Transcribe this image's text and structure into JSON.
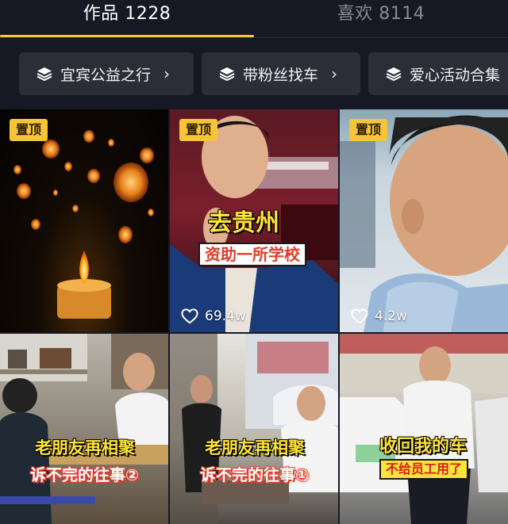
{
  "tabs": {
    "works": "作品 1228",
    "likes": "喜欢 8114"
  },
  "collections": [
    {
      "label": "宜宾公益之行",
      "chevron": "›"
    },
    {
      "label": "带粉丝找车",
      "chevron": "›"
    },
    {
      "label": "爱心活动合集"
    }
  ],
  "videos": [
    {
      "pinned": "置顶"
    },
    {
      "pinned": "置顶",
      "caption_main": "去贵州",
      "caption_sub": "资助一所学校",
      "likes": "69.4w"
    },
    {
      "pinned": "置顶",
      "likes": "4.2w"
    },
    {
      "caption_main": "老朋友再相聚",
      "caption_sub": "诉不完的往事②"
    },
    {
      "caption_main": "老朋友再相聚",
      "caption_sub": "诉不完的往事①"
    },
    {
      "caption_main": "收回我的车",
      "caption_sub": "不给员工用了"
    }
  ],
  "colors": {
    "background": "#161823",
    "accent": "#f7c937",
    "chip_bg": "#2b2d37",
    "pin_badge": "#f6c43a"
  }
}
